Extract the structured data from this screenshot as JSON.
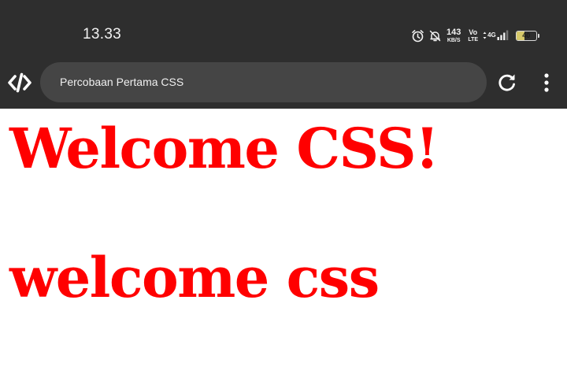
{
  "status_bar": {
    "time": "13.33",
    "net_speed_value": "143",
    "net_speed_unit": "KB/S",
    "volte_top": "Vo",
    "volte_bottom": "LTE",
    "network_type": "4G",
    "battery_level": "40",
    "icons": [
      "alarm-icon",
      "bell-muted-icon",
      "signal-icon",
      "battery-icon"
    ]
  },
  "browser": {
    "logo_icon": "code-app-icon",
    "address_text": "Percobaan Pertama CSS",
    "reload_icon": "reload-icon",
    "menu_icon": "more-vert-icon"
  },
  "page": {
    "heading_1": "Welcome CSS!",
    "heading_2": "welcome css",
    "text_color": "#ff0000"
  },
  "colors": {
    "chrome_background": "#2e2e2e",
    "url_bar_background": "#454545",
    "battery_fill": "#d6c96a",
    "page_background": "#ffffff"
  }
}
